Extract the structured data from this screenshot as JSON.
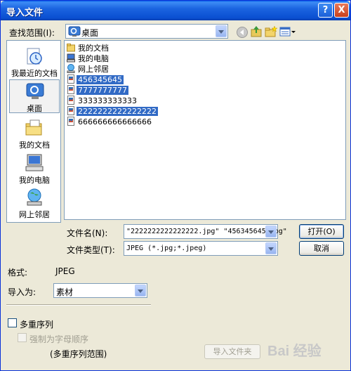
{
  "window": {
    "title": "导入文件"
  },
  "titlebar": {
    "help_label": "?",
    "close_label": "X"
  },
  "lookin": {
    "label": "查找范围(I):",
    "value": "桌面"
  },
  "places": [
    {
      "label": "我最近的文档",
      "icon": "recent-documents-icon"
    },
    {
      "label": "桌面",
      "icon": "desktop-icon"
    },
    {
      "label": "我的文档",
      "icon": "my-documents-icon"
    },
    {
      "label": "我的电脑",
      "icon": "my-computer-icon"
    },
    {
      "label": "网上邻居",
      "icon": "network-places-icon"
    }
  ],
  "files": [
    {
      "name": "我的文档",
      "icon": "folder-icon",
      "selected": false
    },
    {
      "name": "我的电脑",
      "icon": "computer-icon",
      "selected": false
    },
    {
      "name": "网上邻居",
      "icon": "network-icon",
      "selected": false
    },
    {
      "name": "456345645",
      "icon": "image-file-icon",
      "selected": true
    },
    {
      "name": "7777777777",
      "icon": "image-file-icon",
      "selected": true
    },
    {
      "name": "333333333333",
      "icon": "image-file-icon",
      "selected": false
    },
    {
      "name": "2222222222222222",
      "icon": "image-file-icon",
      "selected": true
    },
    {
      "name": "666666666666666",
      "icon": "image-file-icon",
      "selected": false
    }
  ],
  "filename": {
    "label": "文件名(N):",
    "value": "\"2222222222222222.jpg\" \"456345645.jpg\""
  },
  "filetype": {
    "label": "文件类型(T):",
    "value": "JPEG (*.jpg;*.jpeg)"
  },
  "buttons": {
    "open": "打开(O)",
    "cancel": "取消",
    "import_folder": "导入文件夹"
  },
  "format": {
    "label": "格式:",
    "value": "JPEG"
  },
  "import_as": {
    "label": "导入为:",
    "value": "素材"
  },
  "options": {
    "multi_sequence": "多重序列",
    "alpha_order": "强制为字母顺序",
    "range": "(多重序列范围)"
  },
  "watermark": {
    "text": "Bai 经验"
  },
  "colors": {
    "selection": "#316ac5",
    "titlebar": "#0a4fd1",
    "dialog_bg": "#ece9d8"
  }
}
